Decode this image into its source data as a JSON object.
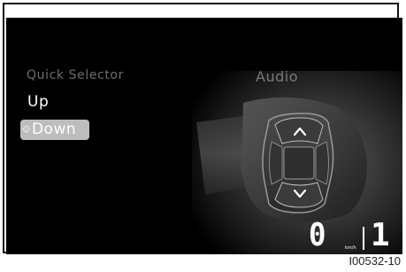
{
  "menu": {
    "title": "Quick Selector",
    "items": [
      {
        "label": "Up",
        "selected": false
      },
      {
        "label": "Down",
        "selected": true
      }
    ],
    "selected_marker": "⟐"
  },
  "panel": {
    "title": "Audio"
  },
  "controller": {
    "up_label": "^",
    "down_label": "v"
  },
  "status": {
    "speed": "0",
    "speed_unit": "km/h",
    "gear": "1"
  },
  "figure_id": "I00532-10",
  "colors": {
    "screen_bg": "#000000",
    "highlight": "#bdbdbd",
    "menu_title": "#6c6c6c"
  }
}
